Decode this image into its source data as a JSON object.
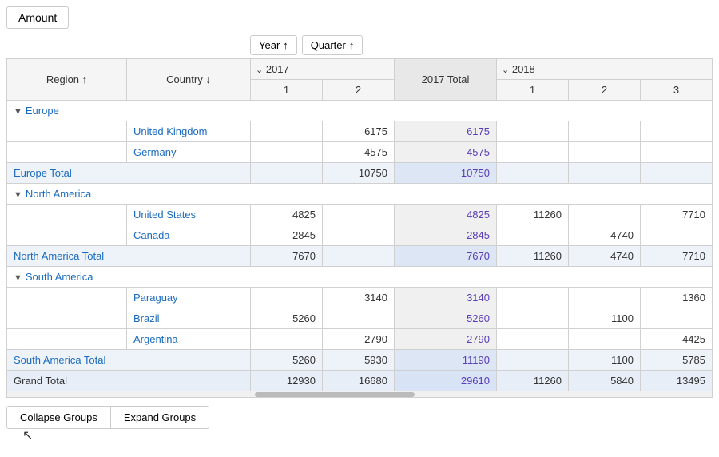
{
  "toolbar": {
    "amount_label": "Amount"
  },
  "sort_buttons": {
    "year_label": "Year",
    "year_arrow": "↑",
    "quarter_label": "Quarter",
    "quarter_arrow": "↑"
  },
  "table": {
    "header_row1": {
      "region_label": "Region",
      "region_sort": "↑",
      "country_label": "Country",
      "country_sort": "↓",
      "year_2017_arrow": "⌄",
      "year_2017": "2017",
      "year_2017_total": "2017 Total",
      "year_2018_arrow": "⌄",
      "year_2018": "2018"
    },
    "header_quarters": {
      "q2017_1": "1",
      "q2017_2": "2",
      "q2018_1": "1",
      "q2018_2": "2",
      "q2018_3": "3"
    },
    "rows": [
      {
        "type": "region",
        "region": "Europe",
        "expanded": true
      },
      {
        "type": "data",
        "country": "United Kingdom",
        "y2017_1": "",
        "y2017_2": "6175",
        "y2017_total": "6175",
        "y2018_1": "",
        "y2018_2": "",
        "y2018_3": ""
      },
      {
        "type": "data",
        "country": "Germany",
        "y2017_1": "",
        "y2017_2": "4575",
        "y2017_total": "4575",
        "y2018_1": "",
        "y2018_2": "",
        "y2018_3": ""
      },
      {
        "type": "total",
        "label": "Europe Total",
        "y2017_1": "",
        "y2017_2": "10750",
        "y2017_total": "10750",
        "y2018_1": "",
        "y2018_2": "",
        "y2018_3": ""
      },
      {
        "type": "region",
        "region": "North America",
        "expanded": true
      },
      {
        "type": "data",
        "country": "United States",
        "y2017_1": "4825",
        "y2017_2": "",
        "y2017_total": "4825",
        "y2018_1": "11260",
        "y2018_2": "",
        "y2018_3": "7710"
      },
      {
        "type": "data",
        "country": "Canada",
        "y2017_1": "2845",
        "y2017_2": "",
        "y2017_total": "2845",
        "y2018_1": "",
        "y2018_2": "4740",
        "y2018_3": ""
      },
      {
        "type": "total",
        "label": "North America Total",
        "y2017_1": "7670",
        "y2017_2": "",
        "y2017_total": "7670",
        "y2018_1": "11260",
        "y2018_2": "4740",
        "y2018_3": "7710"
      },
      {
        "type": "region",
        "region": "South America",
        "expanded": true
      },
      {
        "type": "data",
        "country": "Paraguay",
        "y2017_1": "",
        "y2017_2": "3140",
        "y2017_total": "3140",
        "y2018_1": "",
        "y2018_2": "",
        "y2018_3": "1360"
      },
      {
        "type": "data",
        "country": "Brazil",
        "y2017_1": "5260",
        "y2017_2": "",
        "y2017_total": "5260",
        "y2018_1": "",
        "y2018_2": "1100",
        "y2018_3": ""
      },
      {
        "type": "data",
        "country": "Argentina",
        "y2017_1": "",
        "y2017_2": "2790",
        "y2017_total": "2790",
        "y2018_1": "",
        "y2018_2": "",
        "y2018_3": "4425"
      },
      {
        "type": "total",
        "label": "South America Total",
        "y2017_1": "5260",
        "y2017_2": "5930",
        "y2017_total": "11190",
        "y2018_1": "",
        "y2018_2": "1100",
        "y2018_3": "5785"
      },
      {
        "type": "grand",
        "label": "Grand Total",
        "y2017_1": "12930",
        "y2017_2": "16680",
        "y2017_total": "29610",
        "y2018_1": "11260",
        "y2018_2": "5840",
        "y2018_3": "13495"
      }
    ]
  },
  "footer": {
    "collapse_label": "Collapse Groups",
    "expand_label": "Expand Groups"
  }
}
